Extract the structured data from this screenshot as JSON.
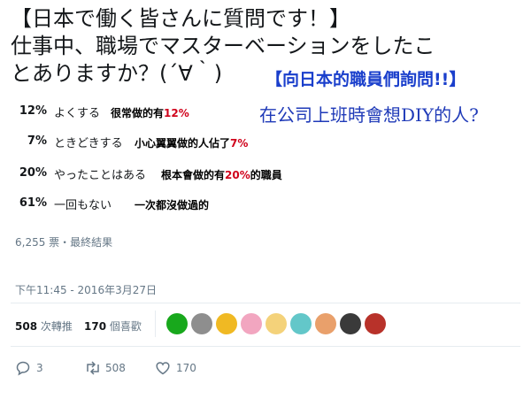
{
  "question": {
    "line1": "【日本で働く皆さんに質問です！】",
    "line2": "仕事中、職場でマスターベーションをしたこ",
    "line3": "とありますか？(´∀｀)"
  },
  "overlay": {
    "title": "【向日本的職員們詢問!!】",
    "subtitle": "在公司上班時會想DIY的人?"
  },
  "poll": {
    "options": [
      {
        "percent_text": "12%",
        "percent": 12,
        "label": "よくする",
        "note_prefix": "很常做的有",
        "note_highlight": "12%",
        "note_suffix": "",
        "leading": false
      },
      {
        "percent_text": "7%",
        "percent": 7,
        "label": "ときどきする",
        "note_prefix": "小心翼翼做的人佔了",
        "note_highlight": "7%",
        "note_suffix": "",
        "leading": false
      },
      {
        "percent_text": "20%",
        "percent": 20,
        "label": "やったことはある",
        "note_prefix": "根本會做的有",
        "note_highlight": "20%",
        "note_suffix": "的職員",
        "leading": false
      },
      {
        "percent_text": "61%",
        "percent": 61,
        "label": "一回もない",
        "note_prefix": "一次都沒做過的",
        "note_highlight": "",
        "note_suffix": "",
        "leading": true
      }
    ],
    "votes_text": "6,255 票・最終結果"
  },
  "timestamp": "下午11:45 - 2016年3月27日",
  "stats": {
    "retweets_count": "508",
    "retweets_label": "次轉推",
    "likes_count": "170",
    "likes_label": "個喜歡"
  },
  "actions": {
    "reply_count": "3",
    "retweet_count": "508",
    "like_count": "170"
  },
  "colors": {
    "bar_default": "#e1e8ed",
    "bar_leading": "#83c4f5",
    "overlay_title": "#1a3fcc",
    "overlay_subtitle": "#1f3ab8",
    "note_highlight": "#d0021b",
    "muted": "#657786"
  },
  "avatars": [
    {
      "name": "avatar-green-circle",
      "color": "#18a81c"
    },
    {
      "name": "avatar-gray-creature",
      "color": "#8e8e8e"
    },
    {
      "name": "avatar-yellow-character",
      "color": "#f0b923"
    },
    {
      "name": "avatar-pink-hair-girl",
      "color": "#f2a6c0"
    },
    {
      "name": "avatar-blonde-girl",
      "color": "#f4d27a"
    },
    {
      "name": "avatar-teal-hair-girl",
      "color": "#63c7c9"
    },
    {
      "name": "avatar-orange-hair-girl",
      "color": "#e9a06b"
    },
    {
      "name": "avatar-dark-hair-person",
      "color": "#3a3a3a"
    },
    {
      "name": "avatar-red-hair-character",
      "color": "#b8322a"
    }
  ]
}
